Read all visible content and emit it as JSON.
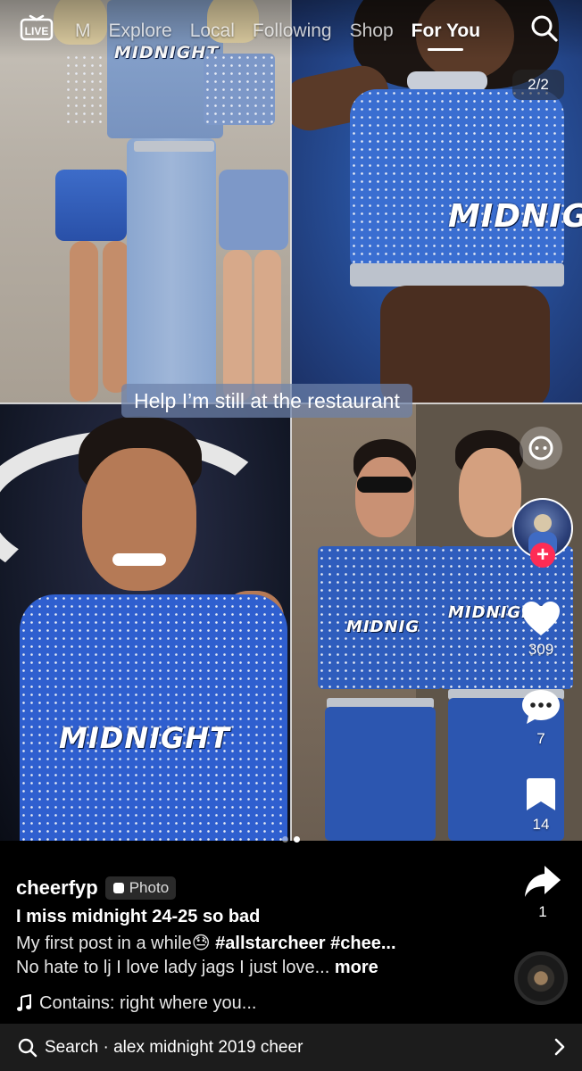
{
  "nav": {
    "live_label": "LIVE",
    "tabs": [
      {
        "label": "M",
        "active": false
      },
      {
        "label": "Explore",
        "active": false
      },
      {
        "label": "Local",
        "active": false
      },
      {
        "label": "Following",
        "active": false
      },
      {
        "label": "Shop",
        "active": false
      },
      {
        "label": "For You",
        "active": true
      }
    ]
  },
  "media": {
    "counter": "2/2",
    "caption": "Help I’m still at the restaurant",
    "jersey_text": "MIDNIGHT",
    "jersey_text_variant": "MIDNIG",
    "current_slide": 2,
    "total_slides": 2
  },
  "rail": {
    "likes": "309",
    "comments": "7",
    "saves": "14",
    "shares": "1",
    "icons": [
      "ai-assist-icon",
      "heart-icon",
      "comment-icon",
      "bookmark-icon",
      "share-icon"
    ]
  },
  "post": {
    "username": "cheerfyp",
    "badge": "Photo",
    "title": "I miss midnight 24-25 so bad",
    "desc_line1_text": "My first post in a while",
    "desc_line1_emoji": "😓",
    "desc_line1_tags": "#allstarcheer #chee...",
    "desc_line2": "No hate to lj I love lady jags I just love...",
    "more": "more",
    "music": "Contains: right where you..."
  },
  "search": {
    "label": "Search",
    "separator": "·",
    "query": "alex midnight 2019 cheer"
  },
  "colors": {
    "follow_red": "#fe2c55",
    "background": "#000000",
    "search_bar": "#1c1c1c"
  }
}
